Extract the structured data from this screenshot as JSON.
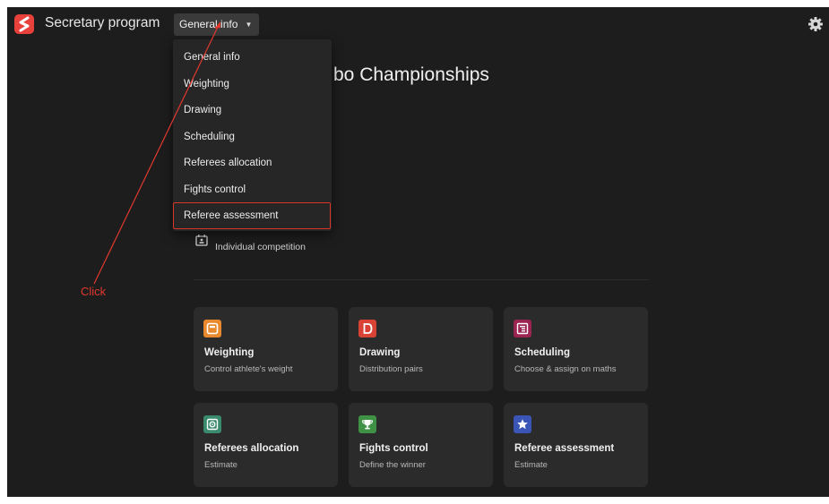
{
  "app": {
    "title": "Secretary program",
    "logo_icon": "secretary-logo-icon",
    "settings_icon": "gear-icon"
  },
  "nav": {
    "selected": "General info",
    "caret_icon": "caret-down-icon"
  },
  "dropdown": {
    "items": [
      {
        "label": "General info"
      },
      {
        "label": "Weighting"
      },
      {
        "label": "Drawing"
      },
      {
        "label": "Scheduling"
      },
      {
        "label": "Referees allocation"
      },
      {
        "label": "Fights control"
      },
      {
        "label": "Referee assessment",
        "highlighted": true
      }
    ]
  },
  "main": {
    "heading_partial": "bo Championships",
    "peek_text": "s",
    "competition_type": "Individual competition",
    "competition_icon": "calendar-person-icon"
  },
  "cards": [
    {
      "title": "Weighting",
      "subtitle": "Control athlete's weight",
      "icon": "scale-icon",
      "color": "#e8892e"
    },
    {
      "title": "Drawing",
      "subtitle": "Distribution pairs",
      "icon": "letter-d-icon",
      "color": "#d84335"
    },
    {
      "title": "Scheduling",
      "subtitle": "Choose & assign on maths",
      "icon": "list-icon",
      "color": "#9b2452"
    },
    {
      "title": "Referees allocation",
      "subtitle": "Estimate",
      "icon": "target-icon",
      "color": "#3a8a6e"
    },
    {
      "title": "Fights control",
      "subtitle": "Define the winner",
      "icon": "trophy-icon",
      "color": "#3e9145"
    },
    {
      "title": "Referee assessment",
      "subtitle": "Estimate",
      "icon": "star-icon",
      "color": "#3a55b5"
    }
  ],
  "annotation": {
    "text": "Click",
    "color": "#e0382e"
  },
  "colors": {
    "background": "#1d1d1d",
    "card": "#2b2b2b",
    "menu": "#262626",
    "highlight_border": "#d9352b"
  }
}
